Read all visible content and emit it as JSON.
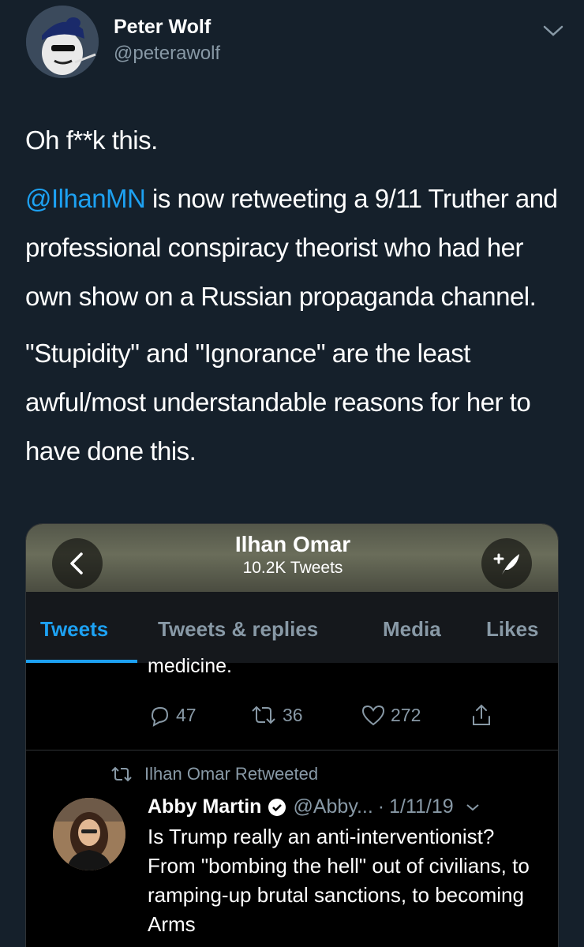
{
  "tweet": {
    "author_name": "Peter Wolf",
    "author_handle": "@peterawolf",
    "line1": "Oh f**k this.",
    "mention": "@IlhanMN",
    "line2_rest": " is now retweeting a 9/11 Truther and professional conspiracy theorist who had her own show on a Russian propaganda channel.",
    "line3": "\"Stupidity\" and \"Ignorance\" are the least awful/most understandable reasons for her to have done this."
  },
  "screenshot": {
    "profile_name": "Ilhan Omar",
    "tweet_count": "10.2K Tweets",
    "tabs": [
      {
        "label": "Tweets"
      },
      {
        "label": "Tweets & replies"
      },
      {
        "label": "Media"
      },
      {
        "label": "Likes"
      }
    ],
    "cut_text": "medicine.",
    "actions": {
      "replies": "47",
      "retweets": "36",
      "likes": "272"
    },
    "retweet_label": "Ilhan Omar Retweeted",
    "rt_author": "Abby Martin",
    "rt_handle": "@Abby...",
    "rt_sep": "·",
    "rt_date": "1/11/19",
    "rt_text": "Is Trump really an anti-interventionist? From \"bombing the hell\" out of civilians, to ramping-up brutal sanctions, to becoming Arms"
  },
  "colors": {
    "background": "#15202b",
    "accent": "#1da1f2",
    "muted": "#8899a6"
  }
}
